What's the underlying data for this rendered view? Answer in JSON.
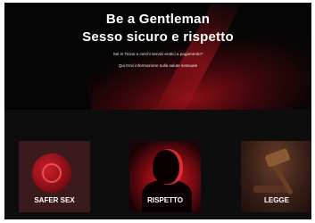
{
  "hero": {
    "title": "Be a Gentleman",
    "subtitle": "Sesso sicuro e rispetto",
    "line1": "Sei in Ticino e cerchi servizi erotici a pagamento?",
    "line2": "Qui trovi informazione sulla salute sessuale"
  },
  "cards": [
    {
      "label": "SAFER SEX",
      "icon": "condom-icon"
    },
    {
      "label": "RISPETTO",
      "icon": "silhouette-icon"
    },
    {
      "label": "LEGGE",
      "icon": "gavel-icon"
    }
  ],
  "colors": {
    "background": "#0b0b0b",
    "accent": "#c8202a",
    "text": "#ffffff"
  }
}
